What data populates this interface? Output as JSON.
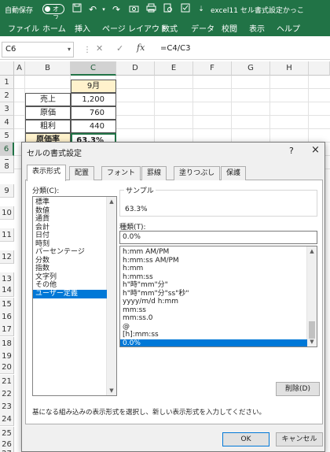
{
  "titlebar": {
    "autosave_label": "自動保存",
    "toggle_state": "オフ",
    "filename": "excel11 セル書式設定かっこ",
    "accent_color": "#217346"
  },
  "ribbon": {
    "tabs": [
      "ファイル",
      "ホーム",
      "挿入",
      "ページ レイアウト",
      "数式",
      "データ",
      "校閲",
      "表示",
      "ヘルプ"
    ]
  },
  "formula_bar": {
    "name_box": "C6",
    "formula": "=C4/C3"
  },
  "grid": {
    "columns": [
      "A",
      "B",
      "C",
      "D",
      "E",
      "F",
      "G",
      "H"
    ],
    "selected_column": "C",
    "rows": [
      "1",
      "2",
      "3",
      "4",
      "5",
      "6",
      "7",
      "8",
      "9",
      "10",
      "11",
      "12",
      "13",
      "14",
      "15",
      "16",
      "17",
      "18",
      "19",
      "20",
      "21",
      "22",
      "23",
      "24",
      "25",
      "26",
      "27"
    ],
    "selected_row": "6",
    "table": {
      "header": "9月",
      "labels": [
        "売上",
        "原価",
        "粗利",
        "原価率"
      ],
      "values": [
        "1,200",
        "760",
        "440",
        "63.3%"
      ]
    }
  },
  "dialog": {
    "title": "セルの書式設定",
    "help": "?",
    "close": "×",
    "tabs": [
      "表示形式",
      "配置",
      "フォント",
      "罫線",
      "塗りつぶし",
      "保護"
    ],
    "active_tab": "表示形式",
    "category_label": "分類(C):",
    "categories": [
      "標準",
      "数値",
      "通貨",
      "会計",
      "日付",
      "時刻",
      "パーセンテージ",
      "分数",
      "指数",
      "文字列",
      "その他",
      "ユーザー定義"
    ],
    "selected_category": "ユーザー定義",
    "sample_label": "サンプル",
    "sample_value": "63.3%",
    "type_label": "種類(T):",
    "type_value": "0.0%",
    "formats": [
      "h:mm AM/PM",
      "h:mm:ss AM/PM",
      "h:mm",
      "h:mm:ss",
      "h\"時\"mm\"分\"",
      "h\"時\"mm\"分\"ss\"秒\"",
      "yyyy/m/d h:mm",
      "mm:ss",
      "mm:ss.0",
      "@",
      "[h]:mm:ss",
      "0.0%"
    ],
    "selected_format": "0.0%",
    "delete_button": "削除(D)",
    "description": "基になる組み込みの表示形式を選択し、新しい表示形式を入力してください。",
    "ok_button": "OK",
    "cancel_button": "キャンセル"
  }
}
